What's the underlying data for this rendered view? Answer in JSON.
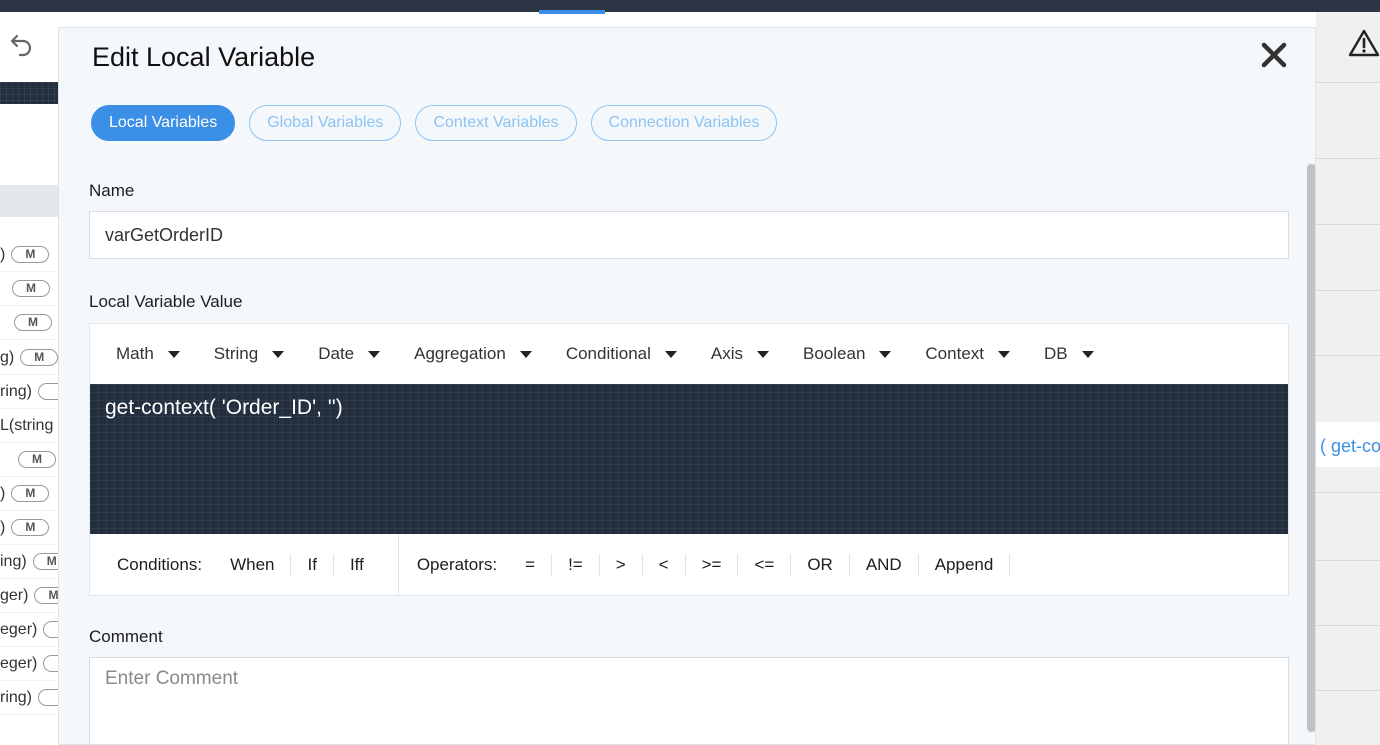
{
  "modal": {
    "title": "Edit Local Variable",
    "tabs": [
      "Local Variables",
      "Global Variables",
      "Context Variables",
      "Connection Variables"
    ],
    "name_label": "Name",
    "name_value": "varGetOrderID",
    "value_label": "Local Variable Value",
    "menus": [
      "Math",
      "String",
      "Date",
      "Aggregation",
      "Conditional",
      "Axis",
      "Boolean",
      "Context",
      "DB"
    ],
    "expression": "get-context( 'Order_ID', '')",
    "conditions_label": "Conditions:",
    "conditions": [
      "When",
      "If",
      "Iff"
    ],
    "operators_label": "Operators:",
    "operators": [
      "=",
      "!=",
      ">",
      "<",
      ">=",
      "<=",
      "OR",
      "AND",
      "Append"
    ],
    "comment_label": "Comment",
    "comment_placeholder": "Enter Comment"
  },
  "left_panel": {
    "rows": [
      {
        "text": ")",
        "pill": "M"
      },
      {
        "text": "",
        "pill": "M"
      },
      {
        "text": "",
        "pill": "M"
      },
      {
        "text": "g)",
        "pill": "M"
      },
      {
        "text": "ring)",
        "pill": ""
      },
      {
        "text": "L(string",
        "pill": ""
      },
      {
        "text": "",
        "pill": "M"
      },
      {
        "text": ")",
        "pill": "M"
      },
      {
        "text": ")",
        "pill": "M"
      },
      {
        "text": "ing)",
        "pill": "M"
      },
      {
        "text": "ger)",
        "pill": "M"
      },
      {
        "text": "eger)",
        "pill": ""
      },
      {
        "text": "eger)",
        "pill": ""
      },
      {
        "text": "ring)",
        "pill": ""
      }
    ]
  },
  "right_panel": {
    "link_text": "( get-co"
  },
  "colors": {
    "accent": "#3b8fe6",
    "editor_bg": "#232f3e",
    "modal_bg": "#f5f8fb"
  }
}
